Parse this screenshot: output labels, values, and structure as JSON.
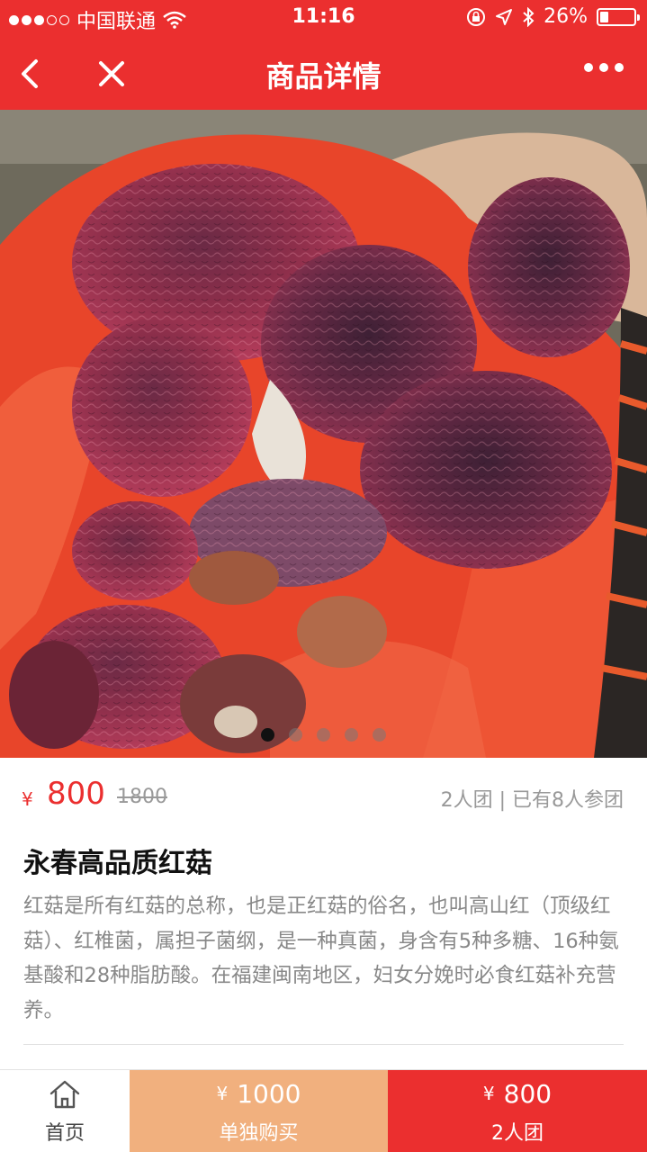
{
  "status_bar": {
    "carrier": "中国联通",
    "time": "11:16",
    "battery": "26%",
    "battery_level": 0.26
  },
  "nav": {
    "title": "商品详情"
  },
  "gallery": {
    "image_count": 5,
    "active_index": 0
  },
  "product": {
    "currency": "¥",
    "price": "800",
    "original_price": "1800",
    "group_info": "2人团 | 已有8人参团",
    "title": "永春高品质红菇",
    "description": "红菇是所有红菇的总称，也是正红菇的俗名，也叫高山红（顶级红菇）、红椎菌，属担子菌纲，是一种真菌，身含有5种多糖、16种氨基酸和28种脂肪酸。在福建闽南地区，妇女分娩时必食红菇补充营养。"
  },
  "bottom_bar": {
    "home_label": "首页",
    "solo": {
      "currency": "¥",
      "price": "1000",
      "label": "单独购买"
    },
    "group": {
      "currency": "¥",
      "price": "800",
      "label": "2人团"
    }
  },
  "colors": {
    "brand_red": "#eb2f2f",
    "solo_orange": "#f1b07e"
  },
  "icons": [
    "wifi-icon",
    "lock-rotation-icon",
    "location-arrow-icon",
    "bluetooth-icon",
    "battery-icon",
    "back-icon",
    "close-icon",
    "more-icon",
    "home-icon"
  ]
}
